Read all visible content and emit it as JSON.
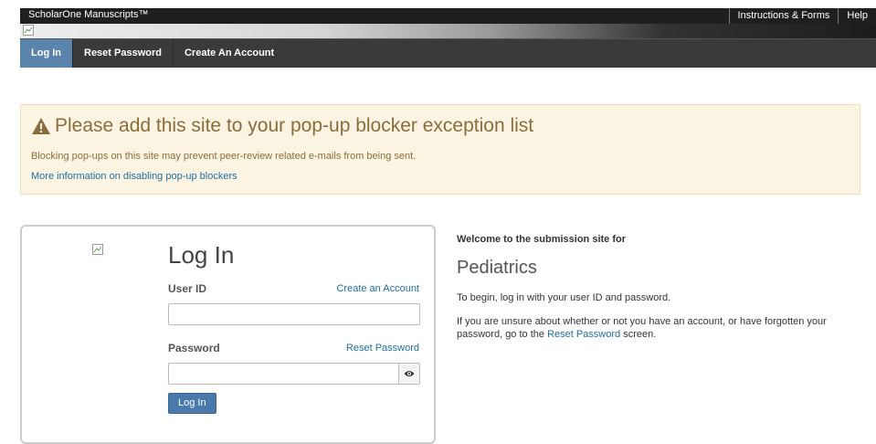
{
  "header": {
    "brand": "ScholarOne Manuscripts™",
    "links": [
      "Instructions & Forms",
      "Help"
    ]
  },
  "nav": {
    "items": [
      {
        "label": "Log In",
        "active": true
      },
      {
        "label": "Reset Password",
        "active": false
      },
      {
        "label": "Create An Account",
        "active": false
      }
    ]
  },
  "alert": {
    "icon": "warning-icon",
    "title": "Please add this site to your pop-up blocker exception list",
    "text": "Blocking pop-ups on this site may prevent peer-review related e-mails from being sent.",
    "link": "More information on disabling pop-up blockers"
  },
  "login": {
    "title": "Log In",
    "user_id_label": "User ID",
    "create_account_link": "Create an Account",
    "user_id_value": "",
    "password_label": "Password",
    "reset_password_link": "Reset Password",
    "password_value": "",
    "toggle_icon": "eye-icon",
    "submit_label": "Log In"
  },
  "welcome": {
    "heading": "Welcome to the submission site for",
    "journal": "Pediatrics",
    "p1": "To begin, log in with your user ID and password.",
    "p2_before": "If you are unsure about whether or not you have an account, or have forgotten your password, go to the ",
    "p2_link": "Reset Password",
    "p2_after": " screen."
  },
  "colors": {
    "nav_active": "#5b84ad",
    "alert_bg": "#fcf4e3",
    "alert_text": "#8a6d3b",
    "link": "#1e6ea0",
    "button": "#4a7aab"
  }
}
